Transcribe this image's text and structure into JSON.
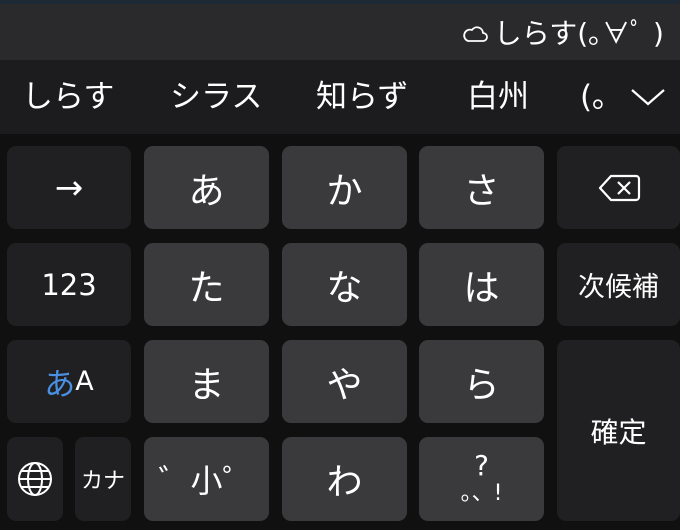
{
  "composition": {
    "icon": "cloud-icon",
    "text": "しらす(｡∀ﾟ )"
  },
  "candidates": {
    "items": [
      "しらす",
      "シラス",
      "知らず",
      "白州",
      "(｡"
    ],
    "expand_icon": "chevron-down-icon"
  },
  "keyboard": {
    "row1": {
      "cursor_key": "→",
      "keys": [
        "あ",
        "か",
        "さ"
      ],
      "backspace_icon": "backspace-icon"
    },
    "row2": {
      "numbers_key": "123",
      "keys": [
        "た",
        "な",
        "は"
      ],
      "next_candidate_key": "次候補"
    },
    "row3": {
      "mode_key_kana": "あ",
      "mode_key_latin": "A",
      "keys": [
        "ま",
        "や",
        "ら"
      ],
      "confirm_key": "確定"
    },
    "row4": {
      "globe_icon": "globe-icon",
      "katakana_key": "カナ",
      "modifier_key": "゛小゜",
      "wa_key": "わ",
      "punct_top": "?",
      "punct_bottom": "。、!"
    },
    "accent_color": "#4a90e2"
  }
}
